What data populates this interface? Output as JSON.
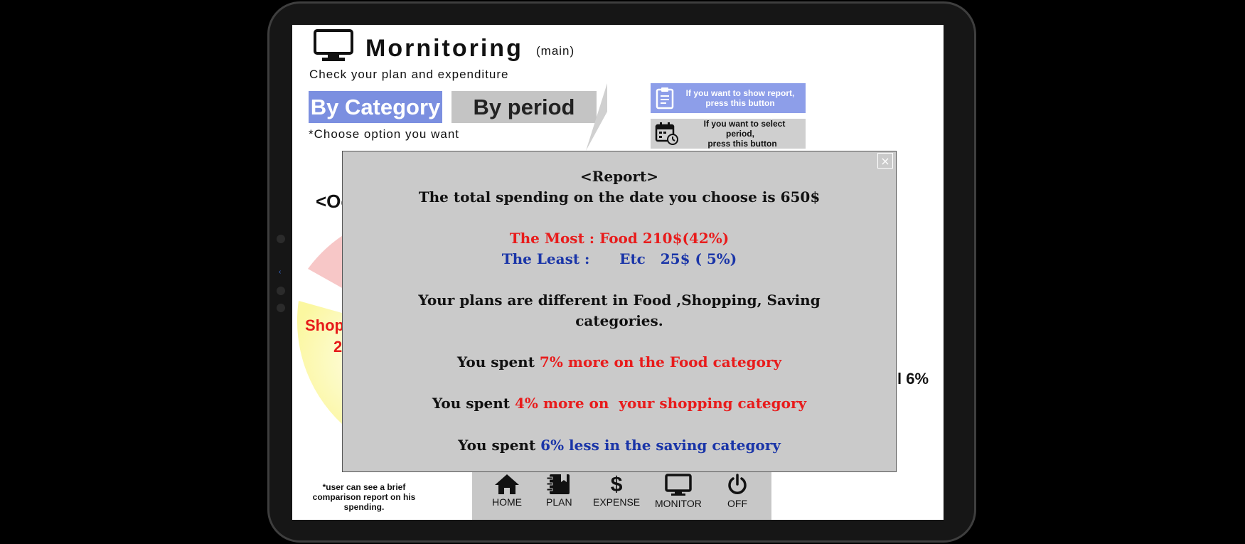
{
  "header": {
    "title": "Mornitoring",
    "title_suffix": "(main)",
    "subtitle": "Check your plan and expenditure"
  },
  "tabs": [
    {
      "label": "By Category",
      "active": true
    },
    {
      "label": "By period",
      "active": false
    }
  ],
  "choose_hint": "*Choose option you want",
  "tooltips": {
    "report_line1": "If you want to show report,",
    "report_line2": "press this button",
    "period_line1": "If you want to select period,",
    "period_line2": "press this button"
  },
  "background": {
    "period_label_partial": "<Oc",
    "shopping_label_partial": "Shop",
    "shopping_value_partial": "2",
    "right_value_partial": "l 6%"
  },
  "footnote": "*user can see a brief comparison report on his spending.",
  "nav": [
    {
      "label": "HOME",
      "icon": "home-icon"
    },
    {
      "label": "PLAN",
      "icon": "notebook-icon"
    },
    {
      "label": "EXPENSE",
      "icon": "dollar-icon"
    },
    {
      "label": "MONITOR",
      "icon": "monitor-icon"
    },
    {
      "label": "OFF",
      "icon": "power-icon"
    }
  ],
  "report": {
    "title": "<Report>",
    "total": "The total spending on the date you choose is 650$",
    "most": "The Most : Food 210$(42%)",
    "least": "The Least :      Etc   25$ ( 5%)",
    "plans_line1": "Your plans are different in Food ,Shopping, Saving",
    "plans_line2": "categories.",
    "food_prefix": "You spent ",
    "food_highlight": "7% more on the Food category",
    "shopping_prefix": "You spent ",
    "shopping_highlight": "4% more on  your shopping category",
    "saving_prefix": "You spent ",
    "saving_highlight": "6% less in the saving category",
    "close": "×"
  },
  "colors": {
    "accent": "#7b8fe0",
    "tab_inactive": "#c4c4c4",
    "most": "#e81c1c",
    "least": "#1a35a8",
    "modal_bg": "#cacaca"
  }
}
